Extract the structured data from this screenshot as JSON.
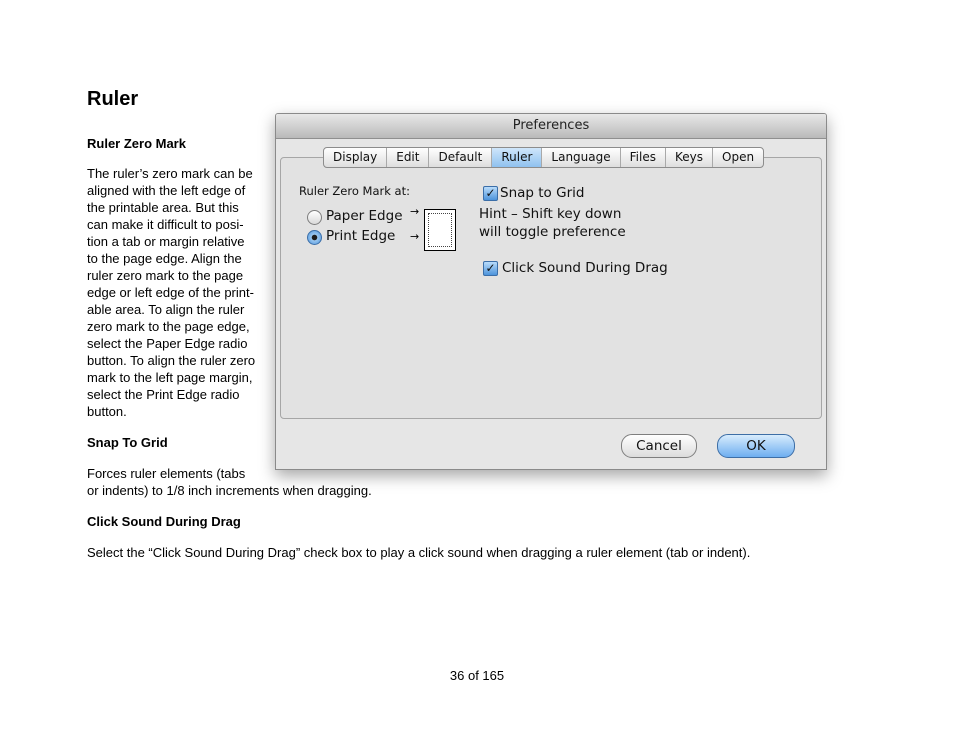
{
  "doc": {
    "title": "Ruler",
    "sections": [
      {
        "heading": "Ruler Zero Mark",
        "lines": [
          "The ruler’s zero mark can be",
          "aligned with the left edge of",
          "the printable area. But this",
          "can make it difficult to posi-",
          "tion a tab or margin relative",
          "to the page edge. Align the",
          "ruler zero mark to the page",
          "edge or left edge of the print-",
          "able area. To align the ruler",
          "zero mark to the page edge,",
          "select the Paper Edge radio",
          "button. To align the ruler zero",
          "mark to the left page margin,",
          "select the Print Edge radio",
          "button."
        ]
      },
      {
        "heading": "Snap To Grid",
        "lines": [
          "Forces ruler elements (tabs",
          "or indents) to 1/8 inch increments when dragging."
        ]
      },
      {
        "heading": "Click Sound During Drag",
        "lines": [
          "Select the “Click Sound During Drag” check box to play a click sound when dragging a ruler element (tab or indent)."
        ]
      }
    ],
    "footer": "36 of 165"
  },
  "dialog": {
    "title": "Preferences",
    "tabs": [
      "Display",
      "Edit",
      "Default",
      "Ruler",
      "Language",
      "Files",
      "Keys",
      "Open"
    ],
    "active_tab": "Ruler",
    "zero_mark_label": "Ruler Zero Mark at:",
    "radio_paper_edge": "Paper Edge",
    "radio_print_edge": "Print Edge",
    "selected_radio": "Print Edge",
    "snap_to_grid_label": "Snap to Grid",
    "snap_to_grid_checked": true,
    "hint_line1": "Hint – Shift key down",
    "hint_line2": "will toggle preference",
    "click_sound_label": "Click Sound During Drag",
    "click_sound_checked": true,
    "cancel_label": "Cancel",
    "ok_label": "OK"
  }
}
